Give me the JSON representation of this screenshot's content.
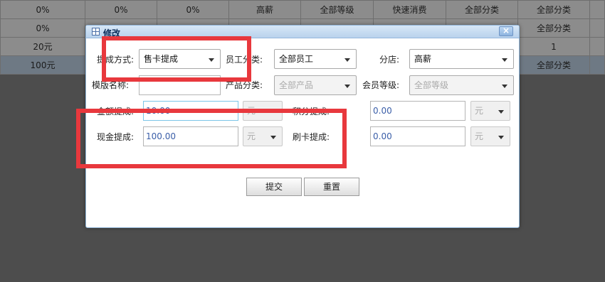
{
  "background_table": {
    "rows": [
      [
        "0%",
        "0%",
        "0%",
        "高薪",
        "全部等级",
        "快速消费",
        "全部分类",
        "全部分类"
      ],
      [
        "0%",
        "",
        "",
        "",
        "",
        "",
        "",
        "全部分类"
      ],
      [
        "20元",
        "",
        "",
        "",
        "",
        "",
        "",
        "1"
      ],
      [
        "100元",
        "",
        "",
        "",
        "",
        "",
        "",
        "全部分类"
      ]
    ]
  },
  "dialog": {
    "title": "修改",
    "close_label": "×",
    "sale_method_label": "提成方式:",
    "sale_method_value": "售卡提成",
    "employee_cat_label": "员工分类:",
    "employee_cat_value": "全部员工",
    "branch_label": "分店:",
    "branch_value": "高薪",
    "template_name_label": "模版名称:",
    "template_name_value": "",
    "product_cat_label": "产品分类:",
    "product_cat_value": "全部产品",
    "member_level_label": "会员等级:",
    "member_level_value": "全部等级",
    "amount_label": "金额提成:",
    "amount_value": "10.00",
    "amount_unit": "元",
    "points_label": "积分提成:",
    "points_value": "0.00",
    "points_unit": "元",
    "cash_label": "现金提成:",
    "cash_value": "100.00",
    "cash_unit": "元",
    "card_label": "刷卡提成:",
    "card_value": "0.00",
    "card_unit": "元",
    "submit_label": "提交",
    "reset_label": "重置"
  },
  "colors": {
    "highlight_box": "#e8383d",
    "dialog_header": "#b9d2ec"
  }
}
